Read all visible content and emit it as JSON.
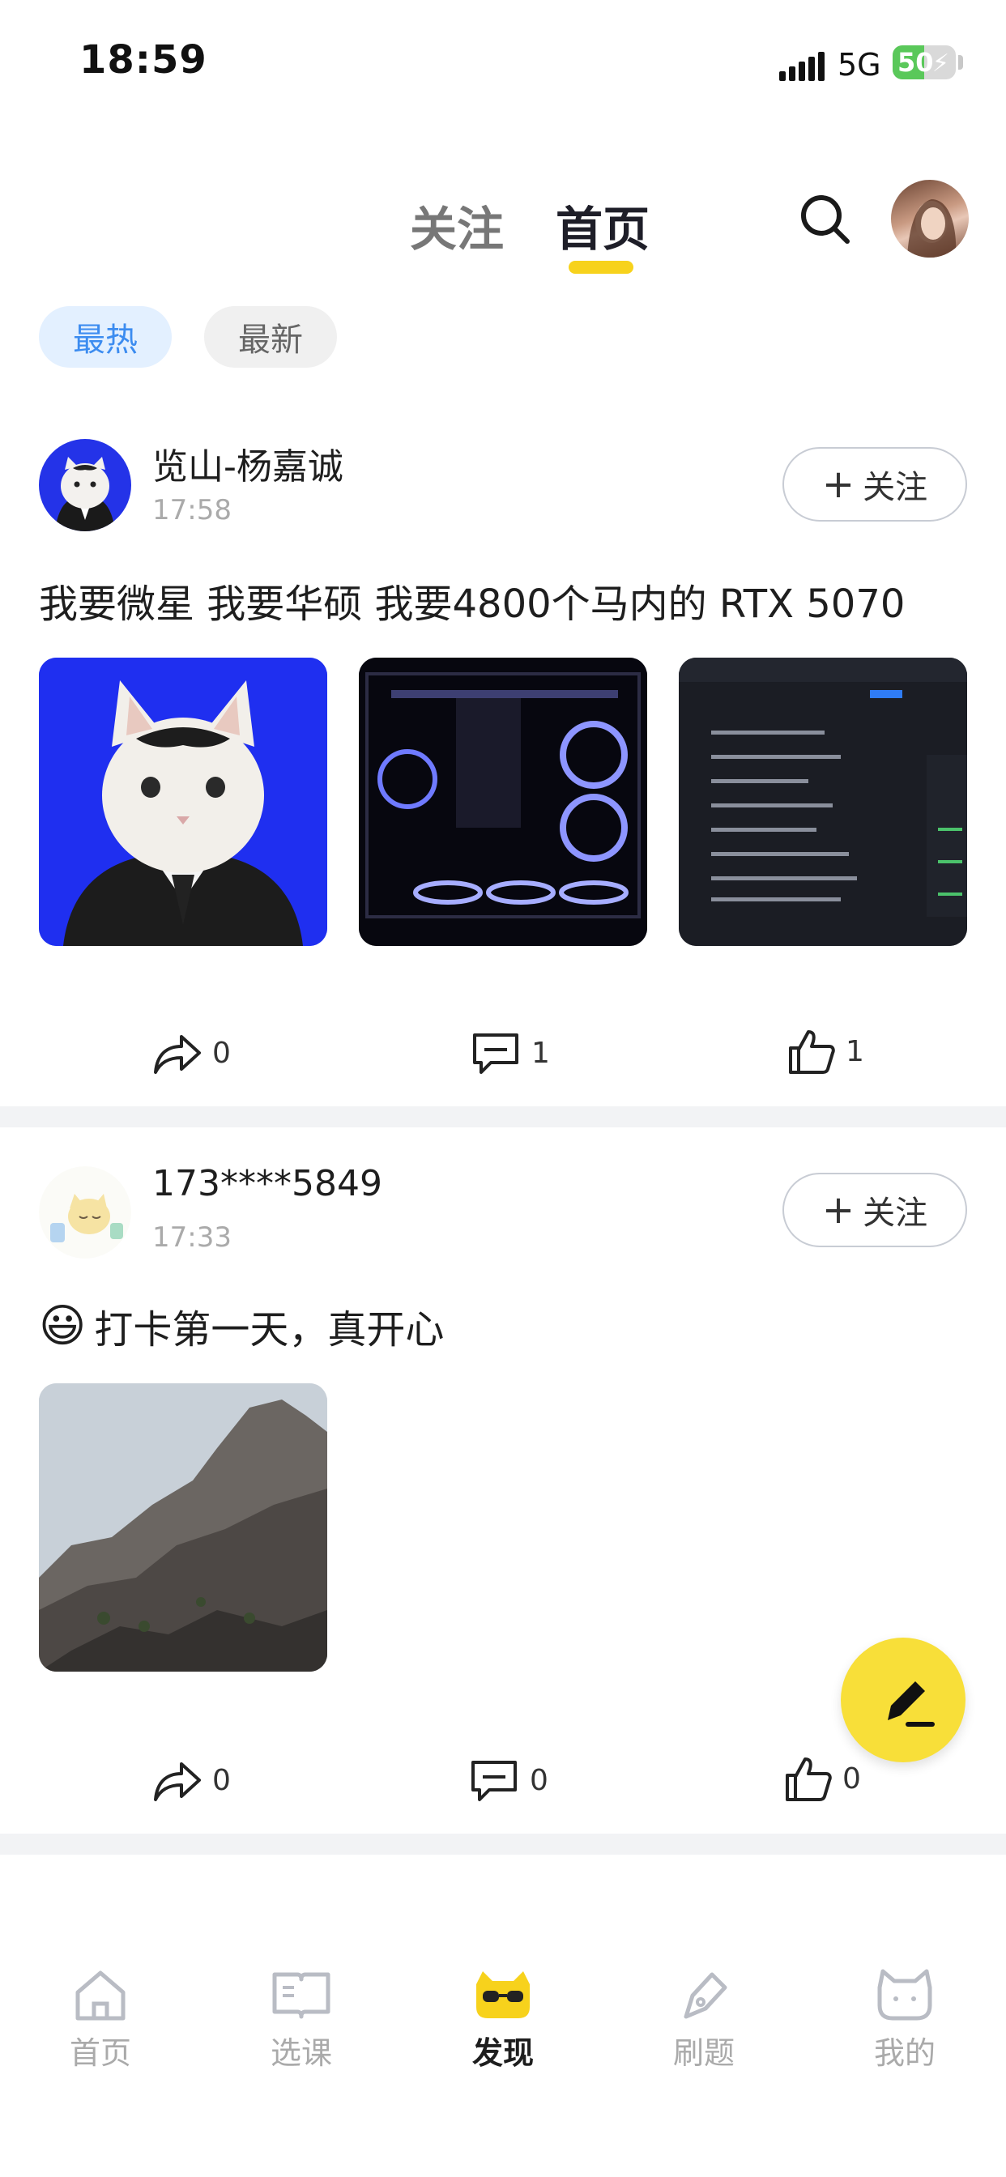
{
  "status_bar": {
    "time": "18:59",
    "network": "5G",
    "battery": "50",
    "battery_level": 0.5
  },
  "header": {
    "tabs": [
      {
        "label": "关注"
      },
      {
        "label": "首页"
      }
    ],
    "active_tab": "首页",
    "search_icon": "search-icon"
  },
  "filters": [
    {
      "label": "最热"
    },
    {
      "label": "最新"
    }
  ],
  "posts": [
    {
      "author": "览山-杨嘉诚",
      "time": "17:58",
      "follow_label": "关注",
      "text": "我要微星 我要华硕 我要4800个马内的 RTX 5070",
      "images": [
        "cat-suit-photo",
        "pc-case-photo",
        "spec-list-screenshot"
      ],
      "actions": {
        "share": "0",
        "comment": "1",
        "like": "1"
      }
    },
    {
      "author": "173****5849",
      "time": "17:33",
      "follow_label": "关注",
      "emoji": "😃",
      "text": "打卡第一天，真开心",
      "images": [
        "mountain-photo"
      ],
      "actions": {
        "share": "0",
        "comment": "0",
        "like": "0"
      }
    }
  ],
  "bottom_nav": [
    {
      "label": "首页",
      "icon": "home-icon"
    },
    {
      "label": "选课",
      "icon": "book-icon"
    },
    {
      "label": "发现",
      "icon": "discover-mascot-icon"
    },
    {
      "label": "刷题",
      "icon": "pen-icon"
    },
    {
      "label": "我的",
      "icon": "cat-profile-icon"
    }
  ],
  "active_nav": "发现",
  "colors": {
    "accent_yellow": "#f7d21c",
    "chip_blue": "#3c8cf0",
    "chip_blue_bg": "#e3f0ff"
  }
}
